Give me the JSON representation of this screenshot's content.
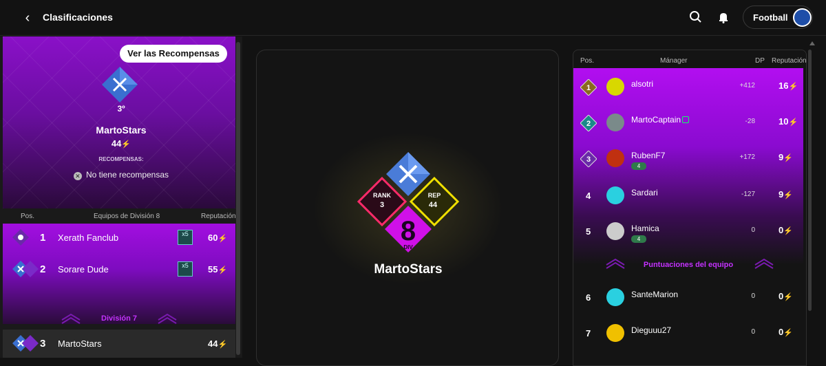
{
  "header": {
    "back_icon": "chevron-left-icon",
    "title": "Clasificaciones",
    "sport_label": "Football"
  },
  "left_card": {
    "rewards_button": "Ver las Recompensas",
    "rank": "3º",
    "manager": "MartoStars",
    "points": "44",
    "rewards_label": "RECOMPENSAS:",
    "no_rewards": "No tiene recompensas"
  },
  "left_table": {
    "col_pos": "Pos.",
    "col_team": "Equipos de División 8",
    "col_rep": "Reputación",
    "rows": [
      {
        "pos": "1",
        "name": "Xerath Fanclub",
        "multiplier": "x5",
        "value": "60"
      },
      {
        "pos": "2",
        "name": "Sorare Dude",
        "multiplier": "x5",
        "value": "55"
      }
    ],
    "division_label": "División 7",
    "my_row": {
      "pos": "3",
      "name": "MartoStars",
      "value": "44"
    }
  },
  "center": {
    "rank_label": "RANK",
    "rank_value": "3",
    "rep_label": "REP",
    "rep_value": "44",
    "div_number": "8",
    "div_label": "DIV",
    "manager": "MartoStars"
  },
  "right_table": {
    "col_pos": "Pos.",
    "col_manager": "Mánager",
    "col_dp": "DP",
    "col_rep": "Reputación",
    "rows": [
      {
        "pos": "1",
        "name": "alsotri",
        "dp": "+412",
        "rep": "16",
        "badge": "",
        "avatar_color": "#d8d800"
      },
      {
        "pos": "2",
        "name": "MartoCaptain",
        "dp": "-28",
        "rep": "10",
        "badge": "",
        "avatar_color": "#7a8a8a"
      },
      {
        "pos": "3",
        "name": "RubenF7",
        "dp": "+172",
        "rep": "9",
        "badge": "4",
        "avatar_color": "#c03010"
      },
      {
        "pos": "4",
        "name": "Sardari",
        "dp": "-127",
        "rep": "9",
        "badge": "",
        "avatar_color": "#2ad0e0"
      },
      {
        "pos": "5",
        "name": "Hamica",
        "dp": "0",
        "rep": "0",
        "badge": "4",
        "avatar_color": "#ccc"
      },
      {
        "pos": "6",
        "name": "SanteMarion",
        "dp": "0",
        "rep": "0",
        "badge": "",
        "avatar_color": "#2ad0e0"
      },
      {
        "pos": "7",
        "name": "Dieguuu27",
        "dp": "0",
        "rep": "0",
        "badge": "",
        "avatar_color": "#f0c000"
      }
    ],
    "team_scores_label": "Puntuaciones del equipo"
  },
  "colors": {
    "accent_purple": "#a20ee0",
    "bolt": "#f5d000",
    "division_text": "#c431ff"
  }
}
